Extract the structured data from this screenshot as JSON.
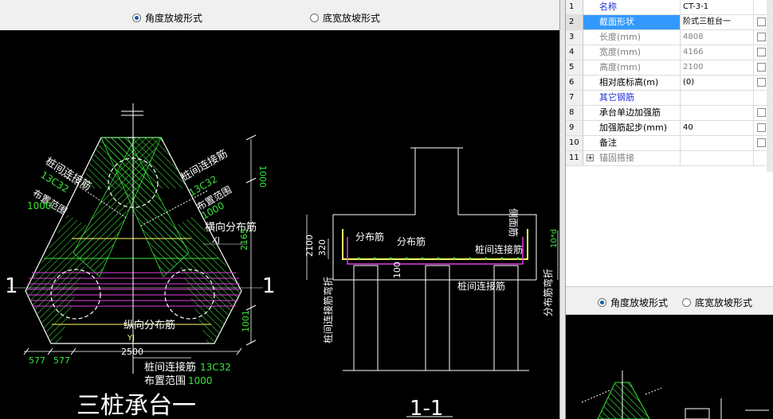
{
  "top_options": {
    "angle_label": "角度放坡形式",
    "width_label": "底宽放坡形式",
    "selected": "angle"
  },
  "drawing": {
    "title_main": "三桩承台一",
    "title_section": "1-1",
    "section_mark": "1",
    "labels": {
      "pile_link_left": "桩间连接筋",
      "rebar_left": "13C32",
      "range_left_label": "布置范围",
      "range_left_value": "1000",
      "pile_link_right": "桩间连接筋",
      "rebar_right": "13C32",
      "range_right_label": "布置范围",
      "range_right_value": "1000",
      "horiz_dist": "横向分布筋",
      "xj": "XJ",
      "vert_dist": "纵向分布筋",
      "yj": "YJ",
      "bottom_link": "桩间连接筋",
      "bottom_rebar": "13C32",
      "bottom_range_label": "布置范围",
      "bottom_range_value": "1000"
    },
    "dims": {
      "d1000": "1000",
      "d2165": "2165",
      "d1001": "1001",
      "d577a": "577",
      "d577b": "577",
      "d2500": "2500",
      "d2100": "2100",
      "d320": "320",
      "d100": "100"
    },
    "section_labels": {
      "dist1": "分布筋",
      "dist2": "分布筋",
      "pile_link": "桩间连接筋",
      "pile_link_bottom": "桩间连接筋",
      "side_rebar": "侧面筋",
      "bend_left": "桩间连接筋弯折",
      "bend_right": "分布筋弯折",
      "bend_right_val": "10*d"
    }
  },
  "properties": {
    "rows": [
      {
        "num": "1",
        "label": "名称",
        "value": "CT-3-1",
        "style": "blue",
        "check": false
      },
      {
        "num": "2",
        "label": "截面形状",
        "value": "阶式三桩台一",
        "style": "sel",
        "check": true
      },
      {
        "num": "3",
        "label": "长度(mm)",
        "value": "4808",
        "style": "gray",
        "check": true
      },
      {
        "num": "4",
        "label": "宽度(mm)",
        "value": "4166",
        "style": "gray",
        "check": true
      },
      {
        "num": "5",
        "label": "高度(mm)",
        "value": "2100",
        "style": "gray",
        "check": true
      },
      {
        "num": "6",
        "label": "相对底标高(m)",
        "value": "(0)",
        "style": "black",
        "check": true
      },
      {
        "num": "7",
        "label": "其它钢筋",
        "value": "",
        "style": "blue",
        "check": false
      },
      {
        "num": "8",
        "label": "承台单边加强筋",
        "value": "",
        "style": "black",
        "check": true
      },
      {
        "num": "9",
        "label": "加强筋起步(mm)",
        "value": "40",
        "style": "black",
        "check": true
      },
      {
        "num": "10",
        "label": "备注",
        "value": "",
        "style": "black",
        "check": true
      },
      {
        "num": "11",
        "label": "锚固搭接",
        "value": "",
        "style": "gray",
        "check": false,
        "expand": "+"
      }
    ]
  },
  "right_options": {
    "angle_label": "角度放坡形式",
    "width_label": "底宽放坡形式",
    "selected": "angle"
  }
}
